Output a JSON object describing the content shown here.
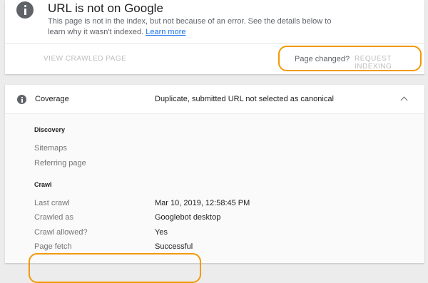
{
  "status": {
    "title": "URL is not on Google",
    "description": "This page is not in the index, but not because of an error. See the details below to learn why it wasn't indexed.",
    "learn_more": "Learn more",
    "view_crawled": "VIEW CRAWLED PAGE",
    "page_changed": "Page changed?",
    "request_indexing": "REQUEST INDEXING"
  },
  "coverage": {
    "label": "Coverage",
    "value": "Duplicate, submitted URL not selected as canonical",
    "discovery_heading": "Discovery",
    "sitemaps_label": "Sitemaps",
    "referring_label": "Referring page",
    "crawl_heading": "Crawl",
    "rows": [
      {
        "label": "Last crawl",
        "value": "Mar 10, 2019, 12:58:45 PM"
      },
      {
        "label": "Crawled as",
        "value": "Googlebot desktop"
      },
      {
        "label": "Crawl allowed?",
        "value": "Yes"
      },
      {
        "label": "Page fetch",
        "value": "Successful"
      }
    ]
  },
  "colors": {
    "highlight": "#f29900",
    "link": "#1a73e8",
    "disabled_button": "#bdbdbd"
  }
}
